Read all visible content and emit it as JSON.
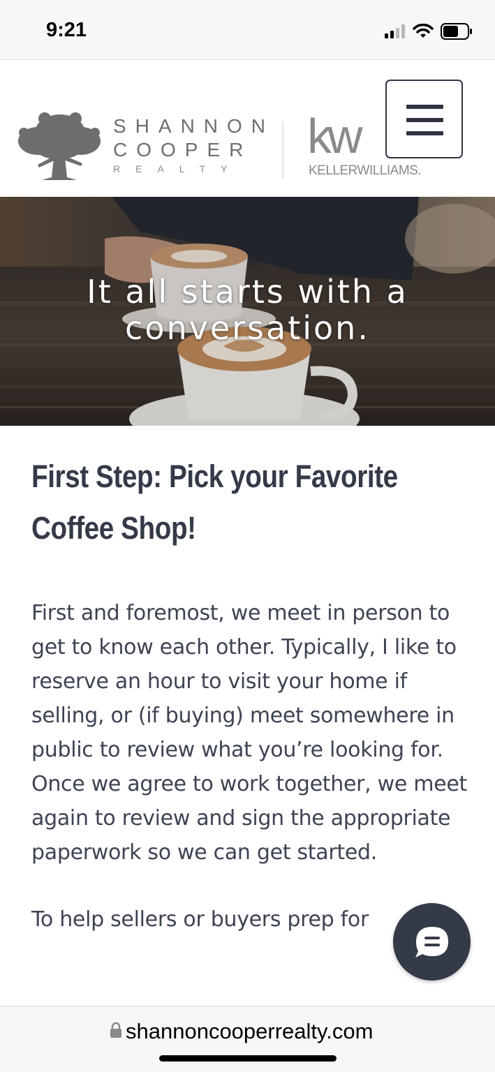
{
  "status_bar": {
    "time": "9:21"
  },
  "header": {
    "logo": {
      "line1": "SHANNON",
      "line2": "COOPER",
      "line3": "REALTY",
      "partner_mark": "kw",
      "partner_name": "KELLERWILLIAMS."
    },
    "menu_icon": "hamburger-icon"
  },
  "hero": {
    "title": "It all starts with a conversation."
  },
  "content": {
    "heading": "First Step: Pick your Favorite Coffee Shop!",
    "paragraph1": "First and foremost, we meet in person to get to know each other. Typically, I like to reserve an hour to visit your home if selling, or (if buying) meet somewhere in public to review what you’re looking for. Once we agree to work together, we meet again to review and sign the appropriate paperwork so we can get started.",
    "paragraph2": "To help sellers or buyers prep for"
  },
  "chat": {
    "icon": "chat-bubble-icon"
  },
  "browser": {
    "url": "shannoncooperrealty.com",
    "lock_icon": "lock-icon"
  },
  "colors": {
    "text": "#3d4352",
    "heading": "#343a48",
    "chat_bg": "#343a48",
    "logo_gray": "#6e6e6e"
  }
}
